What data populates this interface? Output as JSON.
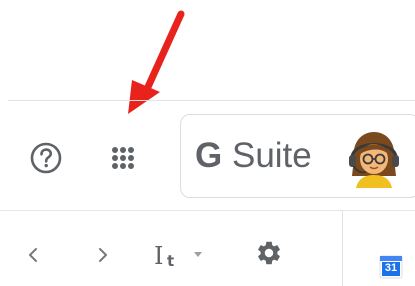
{
  "header": {
    "help_icon": "help-circle-icon",
    "apps_icon": "apps-grid-icon",
    "brand": {
      "g_label": "G",
      "suite_label": "Suite"
    },
    "avatar_icon": "user-avatar-icon"
  },
  "toolbar": {
    "prev_icon": "chevron-left-icon",
    "next_icon": "chevron-right-icon",
    "format_icon": "input-tools-icon",
    "settings_icon": "gear-icon",
    "calendar_badge": "31"
  },
  "annotation": {
    "arrow_color": "#e8231c"
  },
  "colors": {
    "icon_gray": "#5f6368",
    "border": "#dadce0",
    "calendar_blue": "#1a73e8"
  }
}
